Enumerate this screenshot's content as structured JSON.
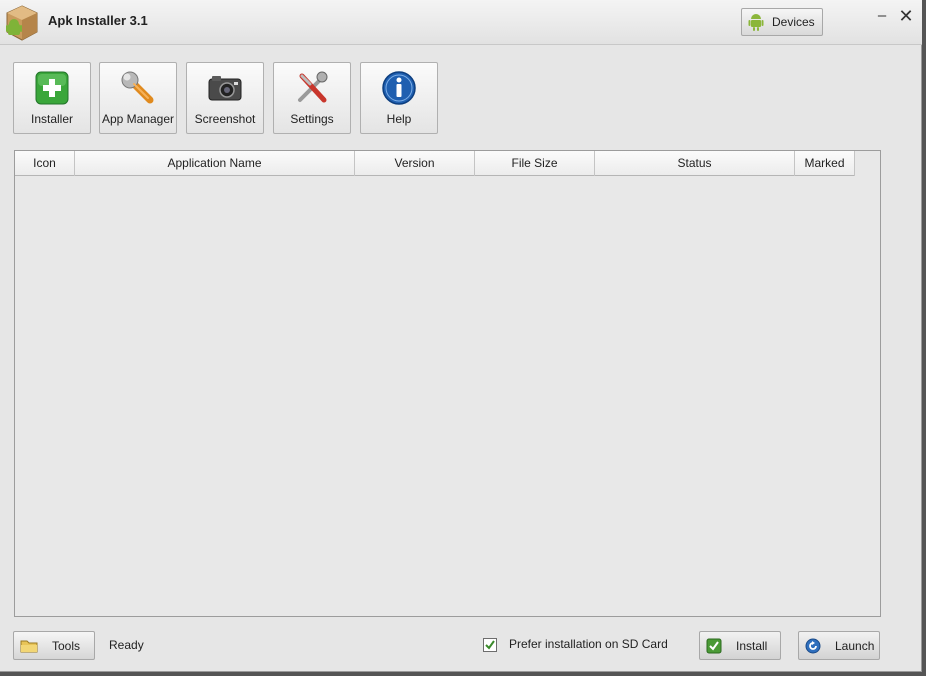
{
  "window": {
    "title": "Apk Installer 3.1",
    "devices_label": "Devices",
    "minimize_glyph": "–",
    "close_glyph": "✕"
  },
  "toolbar": {
    "items": [
      {
        "label": "Installer",
        "icon": "green-plus-icon"
      },
      {
        "label": "App Manager",
        "icon": "wrench-icon"
      },
      {
        "label": "Screenshot",
        "icon": "camera-icon"
      },
      {
        "label": "Settings",
        "icon": "tools-icon"
      },
      {
        "label": "Help",
        "icon": "info-icon"
      }
    ]
  },
  "grid": {
    "columns": [
      "Icon",
      "Application Name",
      "Version",
      "File Size",
      "Status",
      "Marked"
    ],
    "rows": []
  },
  "bottom": {
    "tools_label": "Tools",
    "status": "Ready",
    "prefer_sd_label": "Prefer installation on SD Card",
    "prefer_sd_checked": true,
    "install_label": "Install",
    "launch_label": "Launch"
  },
  "colors": {
    "accent_green": "#3aa63a",
    "android_green": "#8bb63a",
    "info_blue": "#1f5fb0"
  }
}
